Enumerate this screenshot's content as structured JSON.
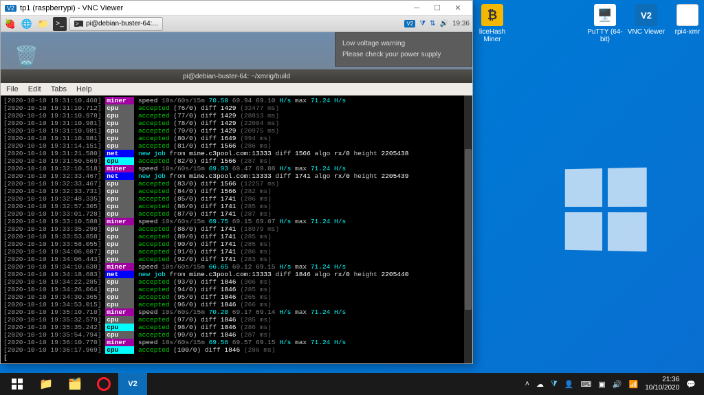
{
  "vnc": {
    "title": "tp1 (raspberrypi) - VNC Viewer"
  },
  "pi_taskbar": {
    "task_label": "pi@debian-buster-64:...",
    "clock": "19:36"
  },
  "voltage": {
    "line1": "Low voltage warning",
    "line2": "Please check your power supply"
  },
  "terminal": {
    "title": "pi@debian-buster-64: ~/xmrig/build",
    "menu": {
      "file": "File",
      "edit": "Edit",
      "tabs": "Tabs",
      "help": "Help"
    }
  },
  "log": [
    {
      "t": "2020-10-10 19:31:10.460",
      "tag": "miner",
      "tclass": "tag-miner",
      "msg": "speed <span class='grey'>10s/60s/15m</span> <span class='cyan'>70.50</span> <span class='grey'>69.94 69.10</span> <span class='cyan'>H/s</span> max <span class='cyan'>71.24 H/s</span>"
    },
    {
      "t": "2020-10-10 19:31:10.712",
      "tag": "cpu",
      "tclass": "tag-cpu",
      "msg": "<span class='green'>accepted</span> (76/0) diff <span class='white'>1429</span> <span class='dkgrey'>(32477 ms)</span>"
    },
    {
      "t": "2020-10-10 19:31:10.978",
      "tag": "cpu",
      "tclass": "tag-cpu",
      "msg": "<span class='green'>accepted</span> (77/0) diff <span class='white'>1429</span> <span class='dkgrey'>(28813 ms)</span>"
    },
    {
      "t": "2020-10-10 19:31:10.981",
      "tag": "cpu",
      "tclass": "tag-cpu",
      "msg": "<span class='green'>accepted</span> (78/0) diff <span class='white'>1429</span> <span class='dkgrey'>(22004 ms)</span>"
    },
    {
      "t": "2020-10-10 19:31:10.981",
      "tag": "cpu",
      "tclass": "tag-cpu",
      "msg": "<span class='green'>accepted</span> (79/0) diff <span class='white'>1429</span> <span class='dkgrey'>(20975 ms)</span>"
    },
    {
      "t": "2020-10-10 19:31:10.981",
      "tag": "cpu",
      "tclass": "tag-cpu",
      "msg": "<span class='green'>accepted</span> (80/0) diff <span class='white'>1649</span> <span class='dkgrey'>(994 ms)</span>"
    },
    {
      "t": "2020-10-10 19:31:14.151",
      "tag": "cpu",
      "tclass": "tag-cpu",
      "msg": "<span class='green'>accepted</span> (81/0) diff <span class='white'>1566</span> <span class='dkgrey'>(286 ms)</span>"
    },
    {
      "t": "2020-10-10 19:31:21.580",
      "tag": "net",
      "tclass": "tag-net",
      "msg": "<span class='cyan'>new job</span> from <span class='white'>mine.c3pool.com:13333</span> diff <span class='white'>1566</span> algo <span class='white'>rx/0</span> height <span class='white'>2205438</span>"
    },
    {
      "t": "2020-10-10 19:31:50.569",
      "tag": "cpu",
      "tclass": "tag-cpu-hl",
      "msg": "<span class='green'>accepted</span> (82/0) diff <span class='white'>1566</span> <span class='dkgrey'>(287 ms)</span>"
    },
    {
      "t": "2020-10-10 19:32:10.518",
      "tag": "miner",
      "tclass": "tag-miner",
      "msg": "speed <span class='grey'>10s/60s/15m</span> <span class='cyan'>69.93</span> <span class='grey'>69.47 69.08</span> <span class='cyan'>H/s</span> max <span class='cyan'>71.24 H/s</span>"
    },
    {
      "t": "2020-10-10 19:32:33.467",
      "tag": "net",
      "tclass": "tag-net",
      "msg": "<span class='cyan'>new job</span> from <span class='white'>mine.c3pool.com:13333</span> diff <span class='white'>1741</span> algo <span class='white'>rx/0</span> height <span class='white'>2205439</span>"
    },
    {
      "t": "2020-10-10 19:32:33.467",
      "tag": "cpu",
      "tclass": "tag-cpu",
      "msg": "<span class='green'>accepted</span> (83/0) diff <span class='white'>1566</span> <span class='dkgrey'>(12257 ms)</span>"
    },
    {
      "t": "2020-10-10 19:32:33.731",
      "tag": "cpu",
      "tclass": "tag-cpu",
      "msg": "<span class='green'>accepted</span> (84/0) diff <span class='white'>1566</span> <span class='dkgrey'>(282 ms)</span>"
    },
    {
      "t": "2020-10-10 19:32:48.335",
      "tag": "cpu",
      "tclass": "tag-cpu",
      "msg": "<span class='green'>accepted</span> (85/0) diff <span class='white'>1741</span> <span class='dkgrey'>(286 ms)</span>"
    },
    {
      "t": "2020-10-10 19:32:57.305",
      "tag": "cpu",
      "tclass": "tag-cpu",
      "msg": "<span class='green'>accepted</span> (86/0) diff <span class='white'>1741</span> <span class='dkgrey'>(285 ms)</span>"
    },
    {
      "t": "2020-10-10 19:33:01.728",
      "tag": "cpu",
      "tclass": "tag-cpu",
      "msg": "<span class='green'>accepted</span> (87/0) diff <span class='white'>1741</span> <span class='dkgrey'>(287 ms)</span>"
    },
    {
      "t": "2020-10-10 19:33:10.588",
      "tag": "miner",
      "tclass": "tag-miner",
      "msg": "speed <span class='grey'>10s/60s/15m</span> <span class='cyan'>69.75</span> <span class='grey'>69.15 69.07</span> <span class='cyan'>H/s</span> max <span class='cyan'>71.24 H/s</span>"
    },
    {
      "t": "2020-10-10 19:33:35.290",
      "tag": "cpu",
      "tclass": "tag-cpu",
      "msg": "<span class='green'>accepted</span> (88/0) diff <span class='white'>1741</span> <span class='dkgrey'>(18979 ms)</span>"
    },
    {
      "t": "2020-10-10 19:33:53.858",
      "tag": "cpu",
      "tclass": "tag-cpu",
      "msg": "<span class='green'>accepted</span> (89/0) diff <span class='white'>1741</span> <span class='dkgrey'>(285 ms)</span>"
    },
    {
      "t": "2020-10-10 19:33:58.055",
      "tag": "cpu",
      "tclass": "tag-cpu",
      "msg": "<span class='green'>accepted</span> (90/0) diff <span class='white'>1741</span> <span class='dkgrey'>(285 ms)</span>"
    },
    {
      "t": "2020-10-10 19:34:06.087",
      "tag": "cpu",
      "tclass": "tag-cpu",
      "msg": "<span class='green'>accepted</span> (91/0) diff <span class='white'>1741</span> <span class='dkgrey'>(286 ms)</span>"
    },
    {
      "t": "2020-10-10 19:34:06.443",
      "tag": "cpu",
      "tclass": "tag-cpu",
      "msg": "<span class='green'>accepted</span> (92/0) diff <span class='white'>1741</span> <span class='dkgrey'>(283 ms)</span>"
    },
    {
      "t": "2020-10-10 19:34:10.638",
      "tag": "miner",
      "tclass": "tag-miner",
      "msg": "speed <span class='grey'>10s/60s/15m</span> <span class='cyan'>66.65</span> <span class='grey'>69.12 69.15</span> <span class='cyan'>H/s</span> max <span class='cyan'>71.24 H/s</span>"
    },
    {
      "t": "2020-10-10 19:34:18.683",
      "tag": "net",
      "tclass": "tag-net",
      "msg": "<span class='cyan'>new job</span> from <span class='white'>mine.c3pool.com:13333</span> diff <span class='white'>1846</span> algo <span class='white'>rx/0</span> height <span class='white'>2205440</span>"
    },
    {
      "t": "2020-10-10 19:34:22.285",
      "tag": "cpu",
      "tclass": "tag-cpu",
      "msg": "<span class='green'>accepted</span> (93/0) diff <span class='white'>1846</span> <span class='dkgrey'>(306 ms)</span>"
    },
    {
      "t": "2020-10-10 19:34:26.064",
      "tag": "cpu",
      "tclass": "tag-cpu",
      "msg": "<span class='green'>accepted</span> (94/0) diff <span class='white'>1846</span> <span class='dkgrey'>(285 ms)</span>"
    },
    {
      "t": "2020-10-10 19:34:30.365",
      "tag": "cpu",
      "tclass": "tag-cpu",
      "msg": "<span class='green'>accepted</span> (95/0) diff <span class='white'>1846</span> <span class='dkgrey'>(265 ms)</span>"
    },
    {
      "t": "2020-10-10 19:34:53.015",
      "tag": "cpu",
      "tclass": "tag-cpu",
      "msg": "<span class='green'>accepted</span> (96/0) diff <span class='white'>1846</span> <span class='dkgrey'>(266 ms)</span>"
    },
    {
      "t": "2020-10-10 19:35:10.710",
      "tag": "miner",
      "tclass": "tag-miner",
      "msg": "speed <span class='grey'>10s/60s/15m</span> <span class='cyan'>70.20</span> <span class='grey'>69.17 69.14</span> <span class='cyan'>H/s</span> max <span class='cyan'>71.24 H/s</span>"
    },
    {
      "t": "2020-10-10 19:35:32.579",
      "tag": "cpu",
      "tclass": "tag-cpu",
      "msg": "<span class='green'>accepted</span> (97/0) diff <span class='white'>1846</span> <span class='dkgrey'>(285 ms)</span>"
    },
    {
      "t": "2020-10-10 19:35:35.242",
      "tag": "cpu",
      "tclass": "tag-cpu-hl",
      "msg": "<span class='green'>accepted</span> (98/0) diff <span class='white'>1846</span> <span class='dkgrey'>(286 ms)</span>"
    },
    {
      "t": "2020-10-10 19:35:54.794",
      "tag": "cpu",
      "tclass": "tag-cpu",
      "msg": "<span class='green'>accepted</span> (99/0) diff <span class='white'>1846</span> <span class='dkgrey'>(287 ms)</span>"
    },
    {
      "t": "2020-10-10 19:36:10.770",
      "tag": "miner",
      "tclass": "tag-miner",
      "msg": "speed <span class='grey'>10s/60s/15m</span> <span class='cyan'>69.56</span> <span class='grey'>69.57 69.15</span> <span class='cyan'>H/s</span> max <span class='cyan'>71.24 H/s</span>"
    },
    {
      "t": "2020-10-10 19:36:17.969",
      "tag": "cpu",
      "tclass": "tag-cpu-hl",
      "msg": "<span class='green'>accepted</span> (100/0) diff <span class='white'>1846</span> <span class='dkgrey'>(286 ms)</span>"
    }
  ],
  "desktop": {
    "nicehash": "liceHash Miner",
    "putty": "PuTTY (64-bit)",
    "vncviewer": "VNC Viewer",
    "rpi4xmr": "rpi4-xmr"
  },
  "win_taskbar": {
    "clock_time": "21:36",
    "clock_date": "10/10/2020"
  }
}
